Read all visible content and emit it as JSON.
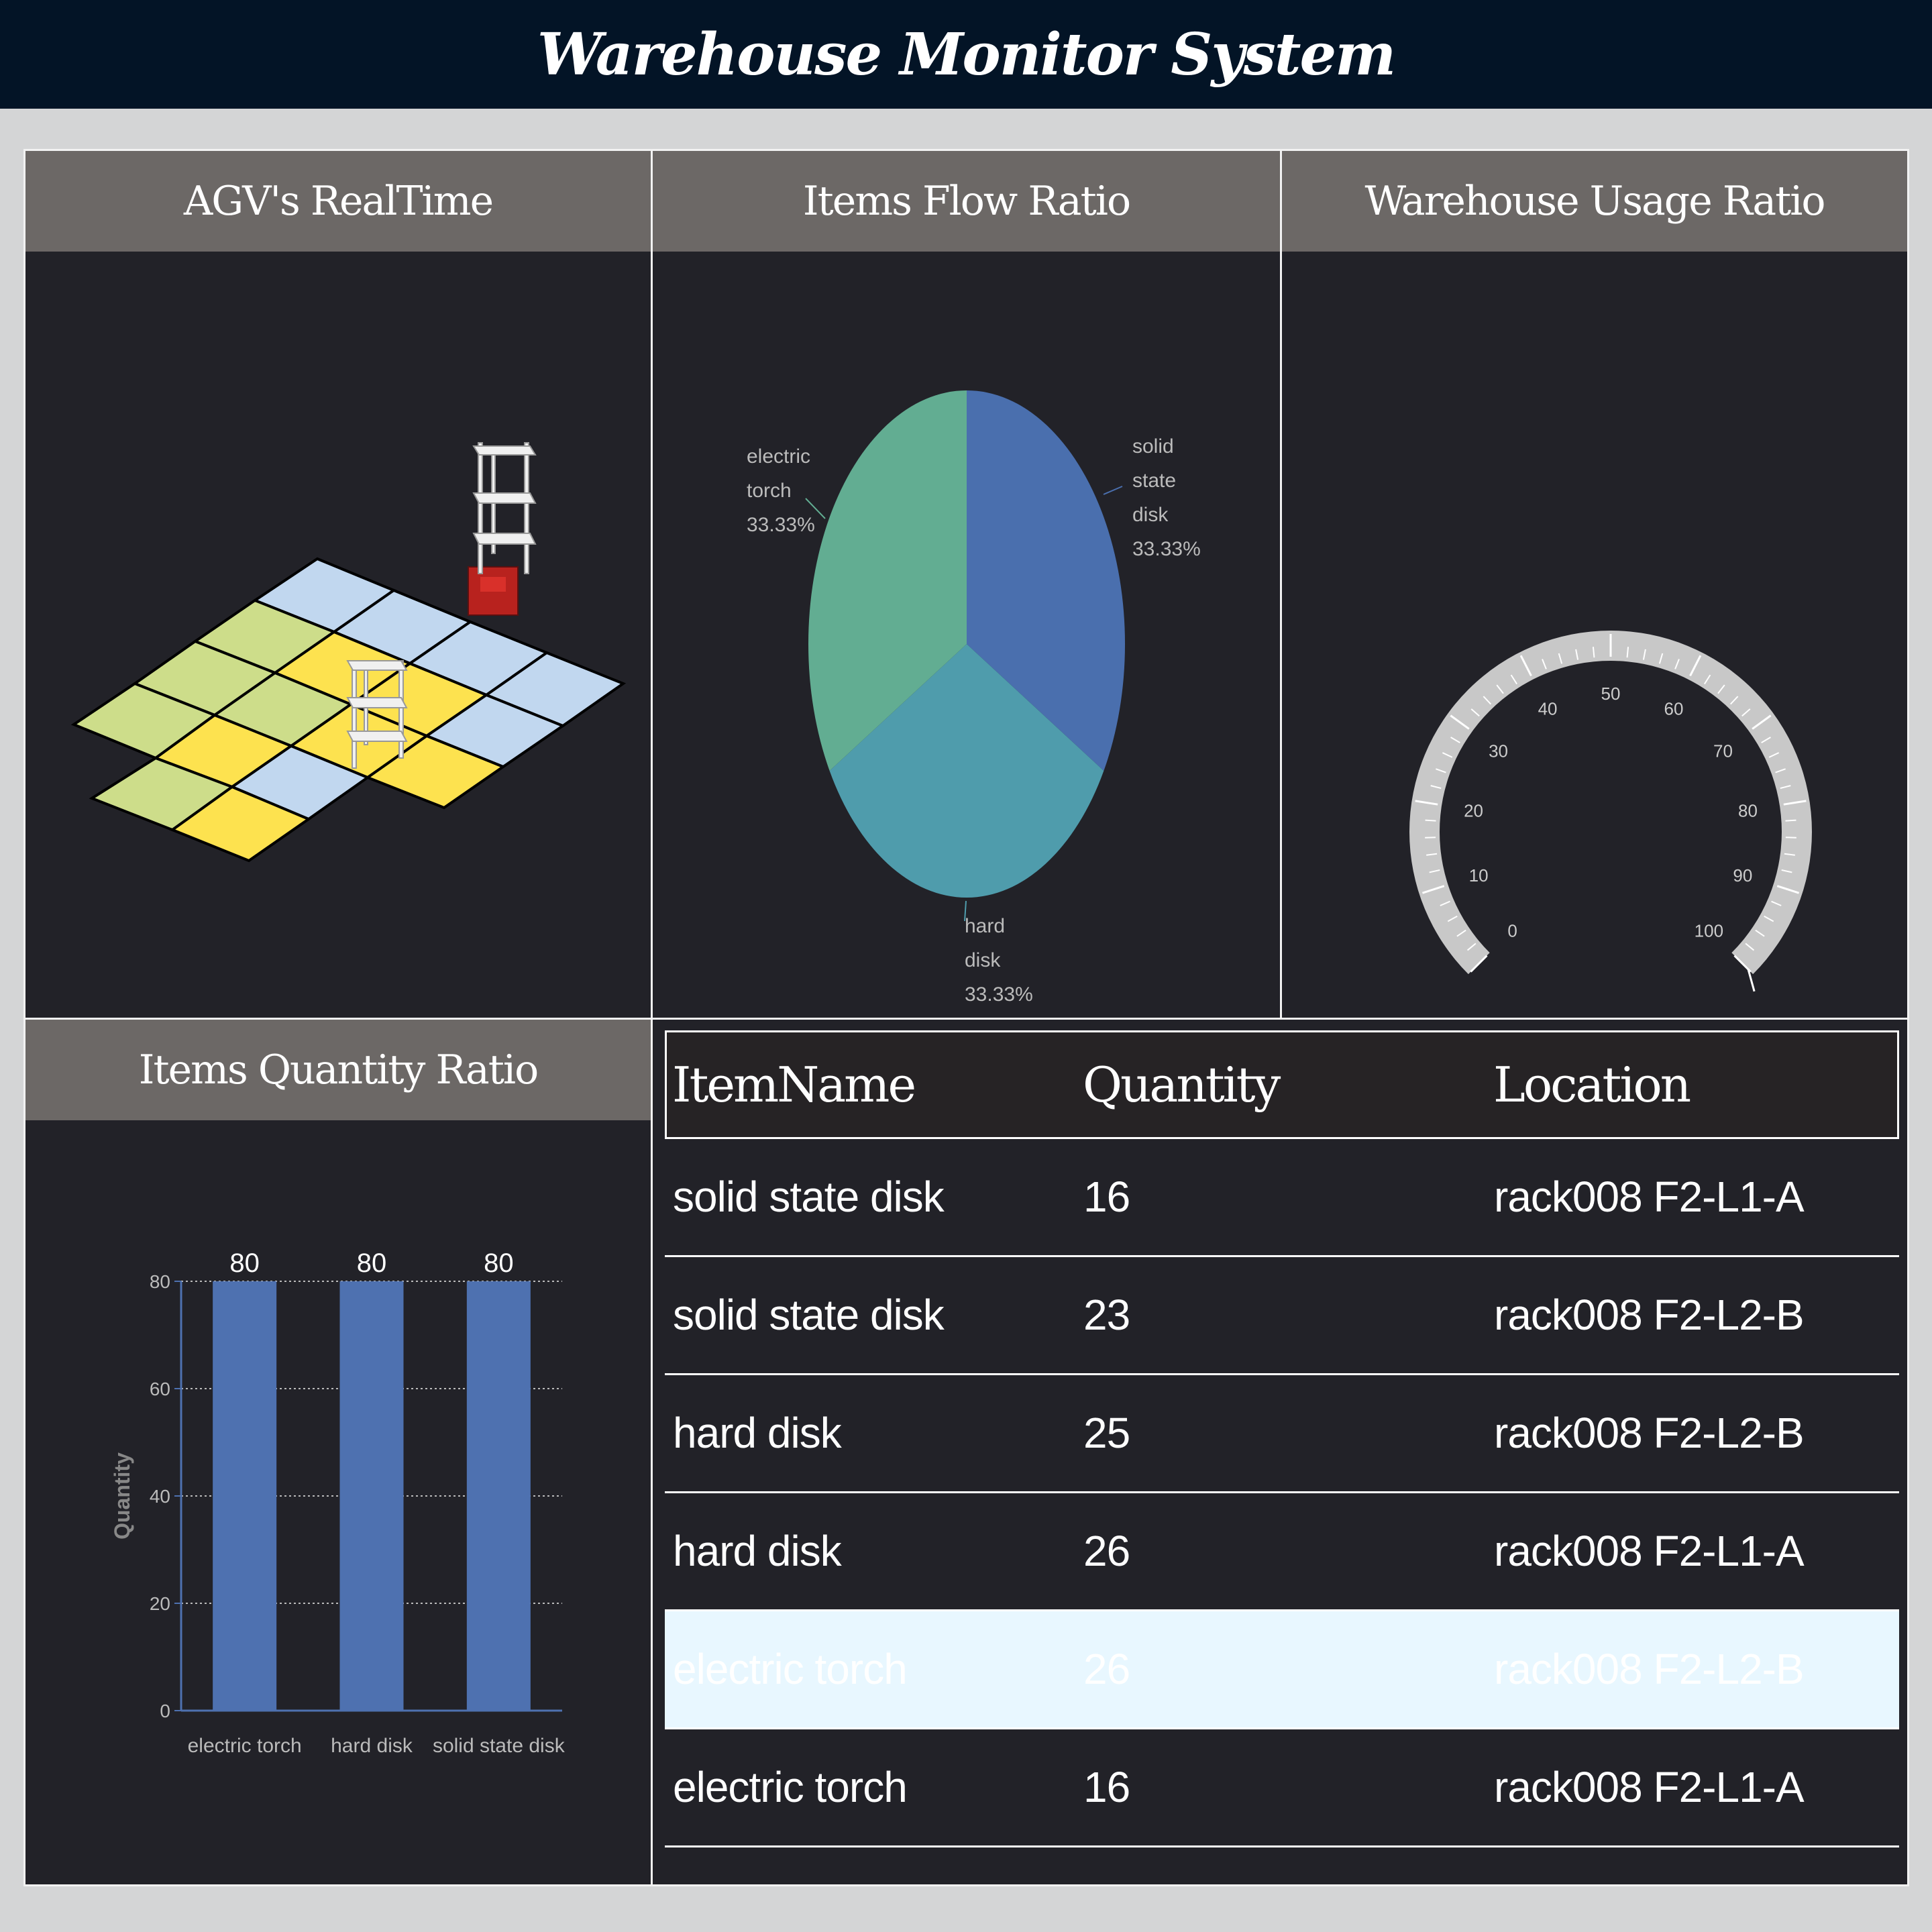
{
  "app": {
    "title": "Warehouse Monitor System"
  },
  "panels": {
    "agv": {
      "title": "AGV's RealTime"
    },
    "flow": {
      "title": "Items Flow Ratio"
    },
    "usage": {
      "title": "Warehouse Usage Ratio"
    },
    "quantity": {
      "title": "Items Quantity Ratio"
    }
  },
  "chart_data": [
    {
      "type": "pie",
      "labels": [
        "solid state disk",
        "hard disk",
        "electric torch"
      ],
      "values": [
        33.33,
        33.33,
        33.33
      ],
      "label_lines": [
        [
          "solid",
          "state",
          "disk",
          "33.33%"
        ],
        [
          "hard",
          "disk",
          "33.33%"
        ],
        [
          "electric",
          "torch",
          "33.33%"
        ]
      ],
      "colors": [
        "#4a6fae",
        "#4f9cac",
        "#62ad92"
      ]
    },
    {
      "type": "gauge",
      "min": 0,
      "max": 100,
      "ticks": [
        "0",
        "10",
        "20",
        "30",
        "40",
        "50",
        "60",
        "70",
        "80",
        "90",
        "100"
      ],
      "value": 100,
      "colors": {
        "arc": "#c8c8c8",
        "tick": "#ffffff",
        "label": "#cccccc"
      }
    },
    {
      "type": "bar",
      "categories": [
        "electric torch",
        "hard disk",
        "solid state disk"
      ],
      "values": [
        80,
        80,
        80
      ],
      "data_labels": [
        "80",
        "80",
        "80"
      ],
      "ylabel": "Quantity",
      "ylim": [
        0,
        80
      ],
      "yticks": [
        "0",
        "20",
        "40",
        "60",
        "80"
      ],
      "grid": true,
      "colors": {
        "bar": "#4e71b0",
        "axis": "#4e71b0"
      }
    }
  ],
  "table": {
    "headers": {
      "name": "ItemName",
      "qty": "Quantity",
      "loc": "Location"
    },
    "rows": [
      {
        "name": "solid state disk",
        "qty": "16",
        "loc": "rack008 F2-L1-A"
      },
      {
        "name": "solid state disk",
        "qty": "23",
        "loc": "rack008 F2-L2-B"
      },
      {
        "name": "hard disk",
        "qty": "25",
        "loc": "rack008 F2-L2-B"
      },
      {
        "name": "hard disk",
        "qty": "26",
        "loc": "rack008 F2-L1-A"
      },
      {
        "name": "electric torch",
        "qty": "26",
        "loc": "rack008 F2-L2-B"
      },
      {
        "name": "electric torch",
        "qty": "16",
        "loc": "rack008 F2-L1-A"
      }
    ],
    "highlighted_row": 4,
    "colors": {
      "highlight": "#e8f7ff"
    }
  },
  "agv_map": {
    "colors": {
      "blue_cell": "#c1d7ef",
      "green_cell": "#cddd8a",
      "yellow_cell": "#fde24f",
      "rack": "#f0f0f0",
      "agv": "#b8221e"
    }
  }
}
